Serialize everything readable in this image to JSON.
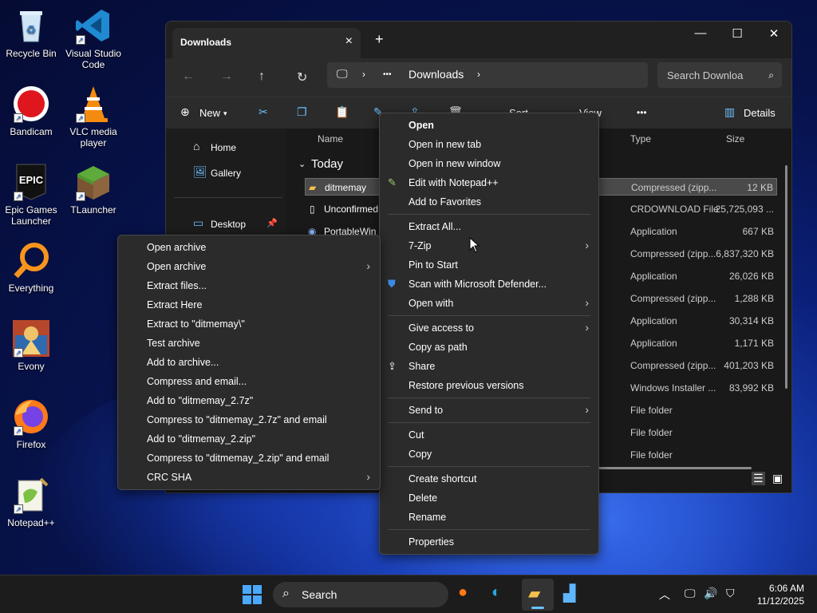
{
  "desktop": {
    "icons": [
      {
        "label": "Recycle Bin"
      },
      {
        "label": "Visual Studio Code"
      },
      {
        "label": "Bandicam"
      },
      {
        "label": "VLC media player"
      },
      {
        "label": "Epic Games Launcher"
      },
      {
        "label": "TLauncher"
      },
      {
        "label": "Everything"
      },
      {
        "label": "Evony"
      },
      {
        "label": "Firefox"
      },
      {
        "label": "Notepad++"
      }
    ],
    "epic_logo": "EPIC"
  },
  "explorer": {
    "tab_title": "Downloads",
    "breadcrumb": {
      "dots": "•••",
      "folder": "Downloads"
    },
    "search_placeholder": "Search Downloa",
    "toolbar": {
      "new_label": "New",
      "sort_label": "Sort",
      "view_label": "View",
      "more": "•••",
      "details_label": "Details"
    },
    "nav": {
      "home": "Home",
      "gallery": "Gallery",
      "desktop": "Desktop"
    },
    "columns": {
      "name": "Name",
      "type": "Type",
      "size": "Size"
    },
    "group": "Today",
    "files": [
      {
        "name": "ditmemay",
        "type": "Compressed (zipp...",
        "size": "12 KB"
      },
      {
        "name": "Unconfirmed",
        "type": "CRDOWNLOAD File",
        "size": "25,725,093 ..."
      },
      {
        "name": "PortableWin",
        "type": "Application",
        "size": "667 KB"
      },
      {
        "name": "",
        "type": "Compressed (zipp...",
        "size": "6,837,320 KB"
      },
      {
        "name": "",
        "type": "Application",
        "size": "26,026 KB"
      },
      {
        "name": "",
        "type": "Compressed (zipp...",
        "size": "1,288 KB"
      },
      {
        "name": "",
        "type": "Application",
        "size": "30,314 KB"
      },
      {
        "name": "",
        "type": "Application",
        "size": "1,171 KB"
      },
      {
        "name": "",
        "type": "Compressed (zipp...",
        "size": "401,203 KB"
      },
      {
        "name": "",
        "type": "Windows Installer ...",
        "size": "83,992 KB"
      },
      {
        "name": "",
        "type": "File folder",
        "size": ""
      },
      {
        "name": "",
        "type": "File folder",
        "size": ""
      },
      {
        "name": "",
        "type": "File folder",
        "size": ""
      }
    ]
  },
  "context_menu": {
    "items": [
      "Open",
      "Open in new tab",
      "Open in new window",
      "Edit with Notepad++",
      "Add to Favorites",
      "Extract All...",
      "7-Zip",
      "Pin to Start",
      "Scan with Microsoft Defender...",
      "Open with",
      "Give access to",
      "Copy as path",
      "Share",
      "Restore previous versions",
      "Send to",
      "Cut",
      "Copy",
      "Create shortcut",
      "Delete",
      "Rename",
      "Properties"
    ]
  },
  "sevenzip_menu": {
    "items": [
      "Open archive",
      "Open archive",
      "Extract files...",
      "Extract Here",
      "Extract to \"ditmemay\\\"",
      "Test archive",
      "Add to archive...",
      "Compress and email...",
      "Add to \"ditmemay_2.7z\"",
      "Compress to \"ditmemay_2.7z\" and email",
      "Add to \"ditmemay_2.zip\"",
      "Compress to \"ditmemay_2.zip\" and email",
      "CRC SHA"
    ]
  },
  "taskbar": {
    "search_label": "Search",
    "time": "6:06 AM",
    "date": "11/12/2025"
  },
  "colors": {
    "accent": "#6cc1ff",
    "menu_bg": "#2b2b2b",
    "window_bg": "#191919"
  }
}
